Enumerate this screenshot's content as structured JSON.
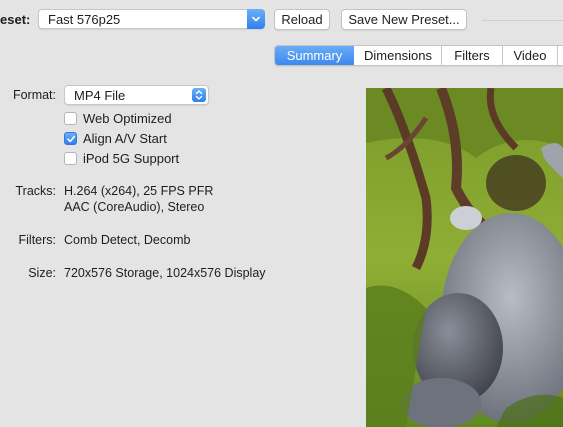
{
  "toolbar": {
    "preset_label": "eset:",
    "preset_value": "Fast 576p25",
    "reload_label": "Reload",
    "save_preset_label": "Save New Preset..."
  },
  "tabs": [
    {
      "label": "Summary",
      "selected": true
    },
    {
      "label": "Dimensions",
      "selected": false
    },
    {
      "label": "Filters",
      "selected": false
    },
    {
      "label": "Video",
      "selected": false
    }
  ],
  "summary": {
    "format_label": "Format:",
    "format_value": "MP4 File",
    "options": [
      {
        "label": "Web Optimized",
        "checked": false
      },
      {
        "label": "Align A/V Start",
        "checked": true
      },
      {
        "label": "iPod 5G Support",
        "checked": false
      }
    ],
    "tracks_label": "Tracks:",
    "tracks_line1": "H.264 (x264), 25 FPS PFR",
    "tracks_line2": "AAC (CoreAudio), Stereo",
    "filters_label": "Filters:",
    "filters_value": "Comb Detect, Decomb",
    "size_label": "Size:",
    "size_value": "720x576 Storage, 1024x576 Display"
  },
  "colors": {
    "accent": "#3d88ee",
    "background": "#e4e4e4"
  }
}
